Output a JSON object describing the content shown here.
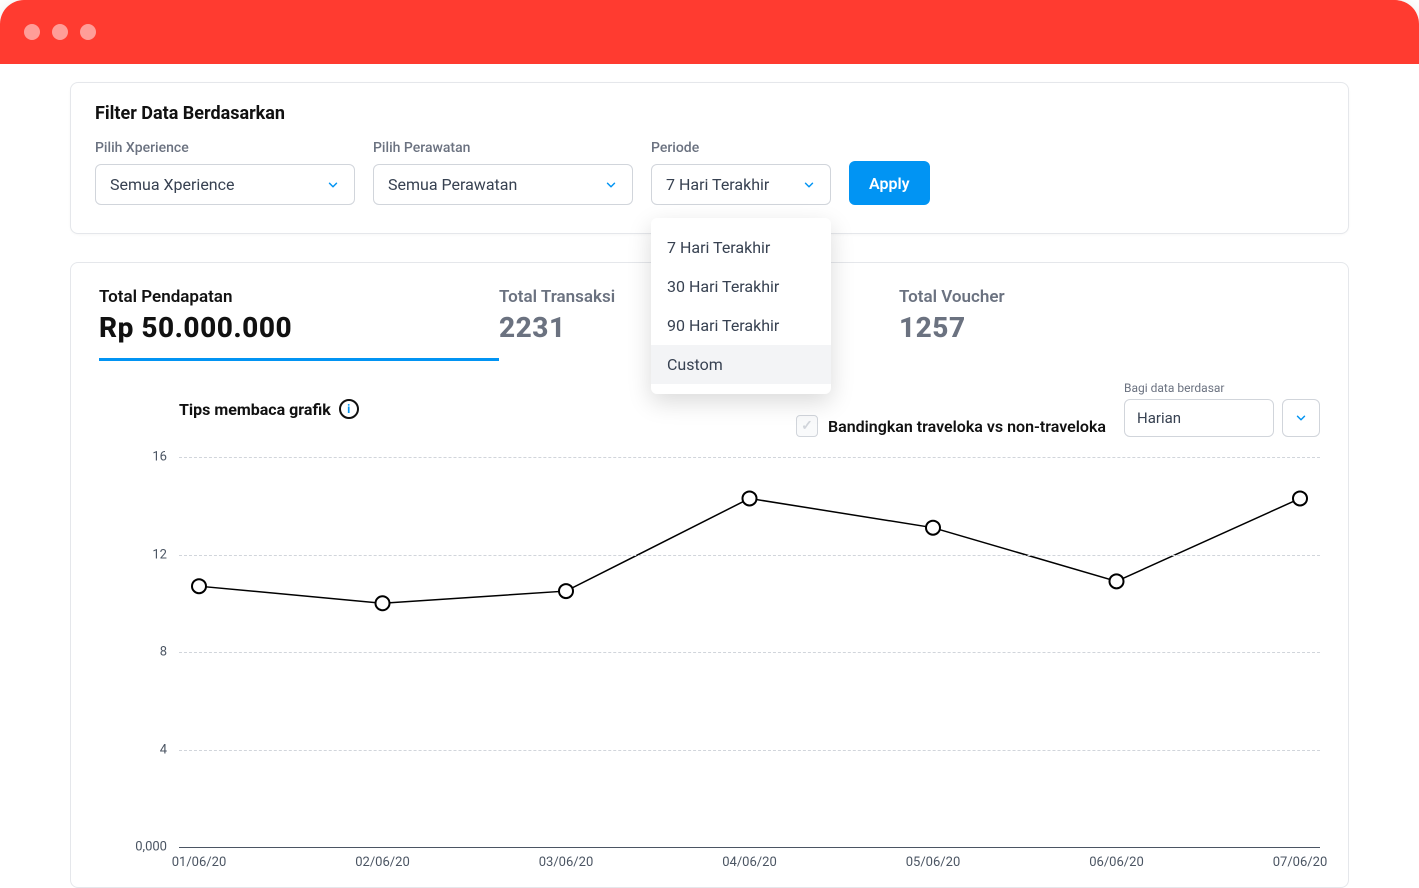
{
  "filter": {
    "title": "Filter Data Berdasarkan",
    "xperience_label": "Pilih Xperience",
    "xperience_value": "Semua Xperience",
    "treatment_label": "Pilih Perawatan",
    "treatment_value": "Semua Perawatan",
    "period_label": "Periode",
    "period_value": "7 Hari Terakhir",
    "apply": "Apply",
    "period_options": [
      "7 Hari Terakhir",
      "30 Hari Terakhir",
      "90 Hari Terakhir",
      "Custom"
    ]
  },
  "tabs": {
    "revenue_label": "Total Pendapatan",
    "revenue_value": "Rp 50.000.000",
    "trans_label": "Total Transaksi",
    "trans_value": "2231",
    "voucher_label": "Total Voucher",
    "voucher_value": "1257"
  },
  "toolbar": {
    "tips": "Tips membaca grafik",
    "compare": "Bandingkan traveloka vs non-traveloka",
    "groupby_label": "Bagi data berdasar",
    "groupby_value": "Harian"
  },
  "chart_data": {
    "type": "line",
    "xlabel": "",
    "ylabel": "",
    "ylim": [
      0,
      16
    ],
    "yticks": [
      "0,000",
      "4",
      "8",
      "12",
      "16"
    ],
    "categories": [
      "01/06/20",
      "02/06/20",
      "03/06/20",
      "04/06/20",
      "05/06/20",
      "06/06/20",
      "07/06/20"
    ],
    "values": [
      10.7,
      10.0,
      10.5,
      14.3,
      13.1,
      10.9,
      14.3
    ]
  }
}
